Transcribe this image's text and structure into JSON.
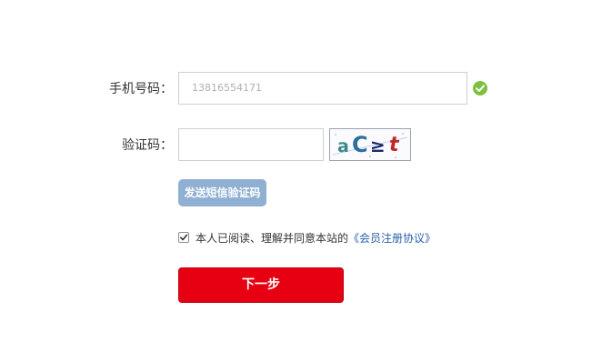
{
  "form": {
    "phone_label": "手机号码：",
    "phone_value": "13816554171",
    "code_label": "验证码：",
    "code_value": "",
    "captcha_text": "aC≥t",
    "send_sms_label": "发送短信验证码",
    "agree_checked": true,
    "agree_text": "本人已阅读、理解并同意本站的",
    "agree_link": "《会员注册协议》",
    "next_label": "下一步"
  },
  "icons": {
    "phone_status": "check-circle-icon",
    "agree_checkbox": "checkmark-icon"
  },
  "colors": {
    "primary_button": "#e60012",
    "sms_button": "#8fb0d3",
    "valid_check": "#7cc13e",
    "link": "#2a62a8"
  }
}
